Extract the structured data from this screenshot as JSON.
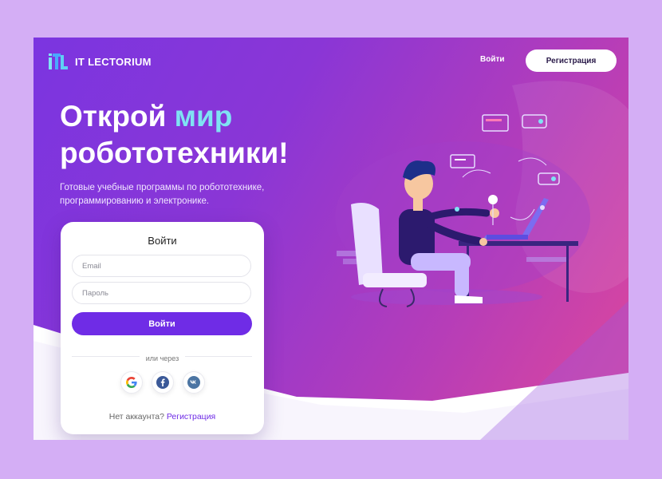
{
  "brand": {
    "name": "IT LECTORIUM",
    "logo_icon": "itl-logo-icon"
  },
  "header": {
    "login_label": "Войти",
    "register_label": "Регистрация"
  },
  "hero": {
    "title_part1": "Открой ",
    "title_accent": "мир",
    "title_part2": "робототехники!",
    "subtitle": "Готовые учебные программы по робототехнике, программированию и электронике."
  },
  "login_card": {
    "title": "Войти",
    "email_placeholder": "Email",
    "password_placeholder": "Пароль",
    "submit_label": "Войти",
    "divider_text": "или через",
    "social": [
      "google-icon",
      "facebook-icon",
      "vk-icon"
    ],
    "no_account_text": "Нет аккаунта?",
    "register_link": "Регистрация"
  },
  "colors": {
    "page_bg": "#d4aef5",
    "gradient_start": "#7b35e0",
    "gradient_end": "#e0489a",
    "accent_text": "#7fe3f3",
    "primary_button": "#6f2ce6"
  }
}
